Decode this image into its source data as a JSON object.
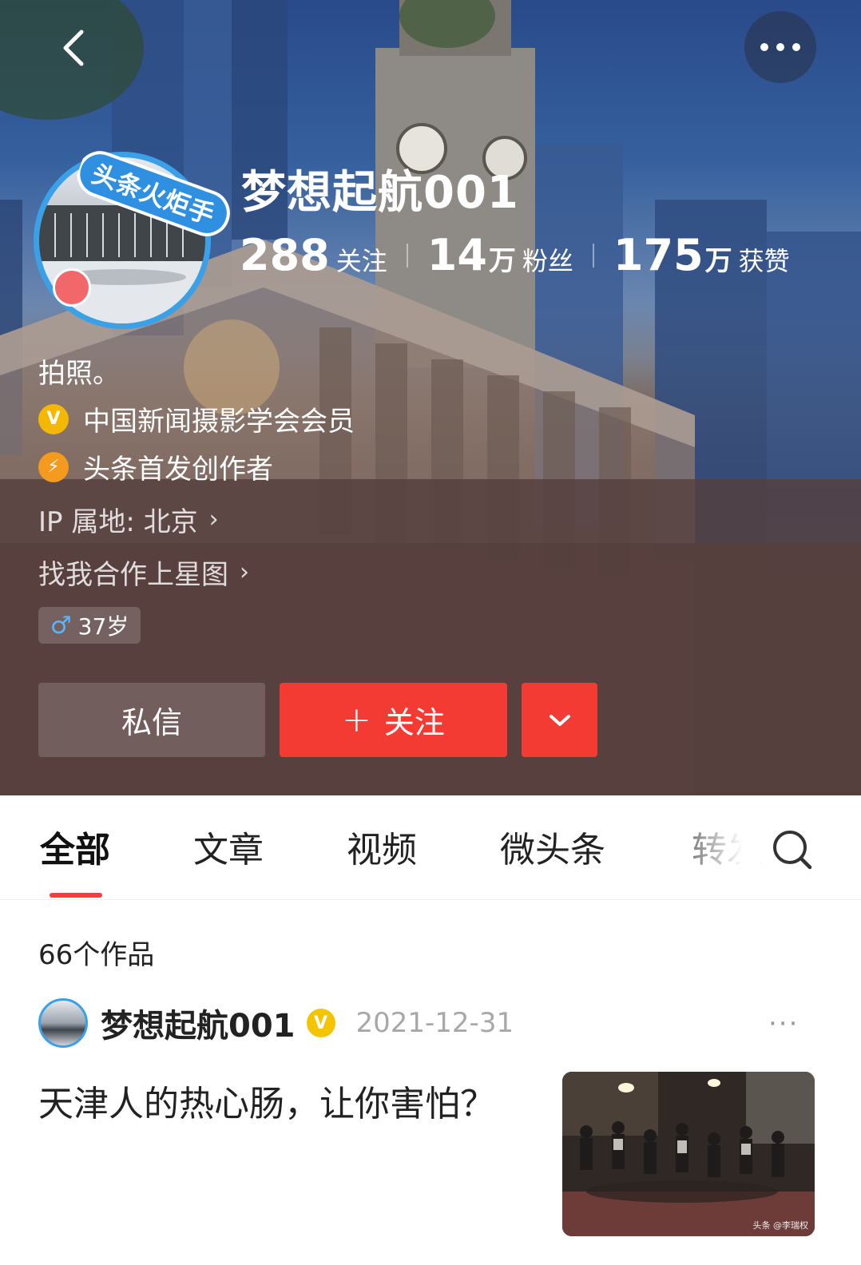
{
  "header": {
    "back_icon": "chevron-left-icon",
    "more_icon": "more-horizontal-icon",
    "avatar_badge": "头条火炬手",
    "username": "梦想起航001",
    "stats": [
      {
        "num": "288",
        "unit": "",
        "label": "关注"
      },
      {
        "num": "14",
        "unit": "万",
        "label": "粉丝"
      },
      {
        "num": "175",
        "unit": "万",
        "label": "获赞"
      }
    ],
    "bio": "拍照。",
    "certifications": [
      {
        "icon": "verified-v-icon",
        "text": "中国新闻摄影学会会员"
      },
      {
        "icon": "lightning-icon",
        "text": "头条首发创作者"
      }
    ],
    "ip_location": "IP 属地: 北京",
    "collab_link": "找我合作上星图",
    "age_tag": "37岁",
    "gender_symbol": "♂",
    "buttons": {
      "message": "私信",
      "follow": "关注",
      "follow_plus": "+",
      "dropdown_icon": "chevron-down-icon"
    }
  },
  "tabs": {
    "items": [
      "全部",
      "文章",
      "视频",
      "微头条",
      "转发"
    ],
    "active_index": 0,
    "search_icon": "search-icon"
  },
  "content": {
    "work_count": "66个作品",
    "posts": [
      {
        "author": "梦想起航001",
        "verified": "V",
        "date": "2021-12-31",
        "more": "···",
        "title": "天津人的热心肠，让你害怕？",
        "thumb_caption": "头条 @李瑞权"
      }
    ]
  },
  "colors": {
    "accent_red": "#f43b33",
    "tab_indicator": "#f04142",
    "verified_gold": "#f5c400",
    "avatar_ring": "#3aa0e8"
  }
}
